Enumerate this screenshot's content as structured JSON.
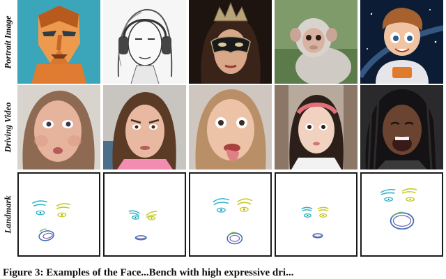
{
  "figure": {
    "row_labels": [
      "Portrait Image",
      "Driving Video",
      "Landmark"
    ],
    "caption_visible": "Figure 3: Examples of the Face...Bench with high expressive dri..."
  },
  "portraits": [
    {
      "subject": "origami-style-man-icon"
    },
    {
      "subject": "pencil-sketch-woman-headphones-icon"
    },
    {
      "subject": "woman-masquerade-mask-icon"
    },
    {
      "subject": "baby-monkey-icon"
    },
    {
      "subject": "cartoon-astronaut-boy-icon"
    }
  ],
  "drivers": [
    {
      "subject": "woman-puffed-cheeks-icon"
    },
    {
      "subject": "woman-frowning-icon"
    },
    {
      "subject": "woman-tongue-out-icon"
    },
    {
      "subject": "woman-headband-icon"
    },
    {
      "subject": "woman-laughing-icon"
    }
  ],
  "colors": {
    "landmark_eye": "#2fb7c9",
    "landmark_brow_left": "#33b5c6",
    "landmark_brow_right": "#c8cc1e",
    "landmark_mouth_outer": "#3e6fb8",
    "landmark_mouth_inner": "#7a5fb0",
    "border": "#1a1a1a"
  }
}
